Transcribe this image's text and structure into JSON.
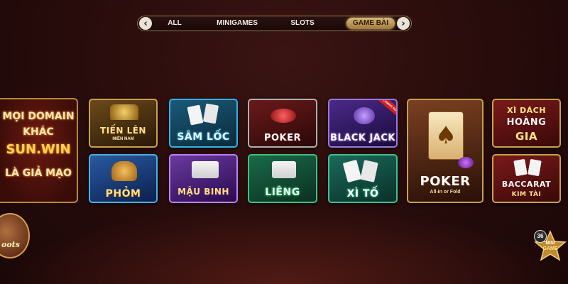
{
  "nav": {
    "tabs": [
      {
        "label": "ALL",
        "active": false
      },
      {
        "label": "MINIGAMES",
        "active": false
      },
      {
        "label": "SLOTS",
        "active": false
      },
      {
        "label": "GAME BÀI",
        "active": true
      }
    ]
  },
  "promo": {
    "lines": [
      "MỌI DOMAIN",
      "KHÁC",
      "SUN.WIN",
      "LÀ GIẢ MẠO"
    ]
  },
  "games": {
    "tien_len": {
      "title": "TIẾN LÊN",
      "subtitle": "MIỀN NAM"
    },
    "sam_loc": {
      "title": "SÂM LỐC"
    },
    "poker": {
      "title": "POKER"
    },
    "black_jack": {
      "title": "BLACK JACK",
      "ribbon": "COMING SOON"
    },
    "poker_allin": {
      "title": "POKER",
      "subtitle": "All-in or Fold"
    },
    "xi_dach": {
      "title_1": "XÌ DÁCH",
      "title_2": "HOÀNG",
      "title_3": "GIA"
    },
    "phom": {
      "title": "PHỎM"
    },
    "mau_binh": {
      "title": "MẬU BINH"
    },
    "lieng": {
      "title": "LIÊNG"
    },
    "xi_to": {
      "title": "XÌ TỐ"
    },
    "baccarat": {
      "title": "BACCARAT",
      "subtitle": "KIM TÀI"
    }
  },
  "badges": {
    "shoots_label": "oots",
    "minigame_count": "36",
    "minigame_label_1": "MINI",
    "minigame_label_2": "GAME"
  },
  "colors": {
    "gold": "#d8b678",
    "background": "#2a0d0c"
  }
}
